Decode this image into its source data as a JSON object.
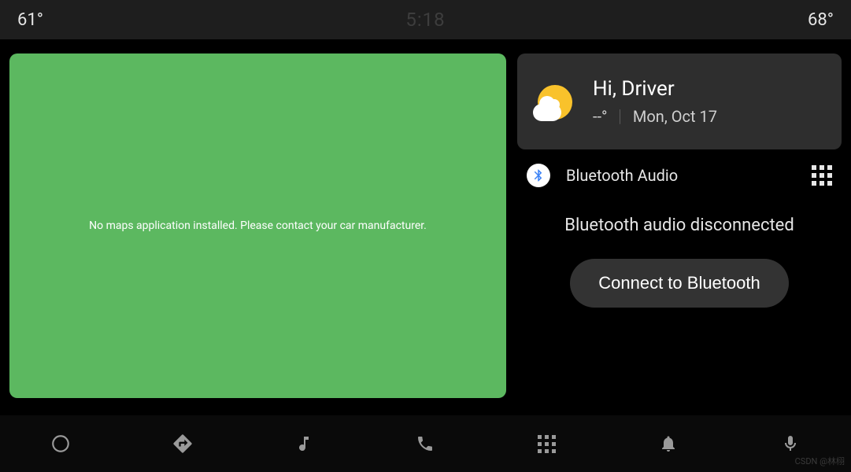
{
  "status_bar": {
    "left_temp": "61°",
    "time": "5:18",
    "right_temp": "68°"
  },
  "map_card": {
    "message": "No maps application installed. Please contact your car manufacturer."
  },
  "weather_card": {
    "greeting": "Hi, Driver",
    "temp": "--°",
    "date": "Mon, Oct 17"
  },
  "audio": {
    "source_label": "Bluetooth Audio",
    "status": "Bluetooth audio disconnected",
    "connect_label": "Connect to Bluetooth"
  },
  "nav": {
    "items": [
      "home",
      "navigation",
      "music",
      "phone",
      "apps",
      "notifications",
      "voice"
    ]
  },
  "watermark": "CSDN @林栩"
}
